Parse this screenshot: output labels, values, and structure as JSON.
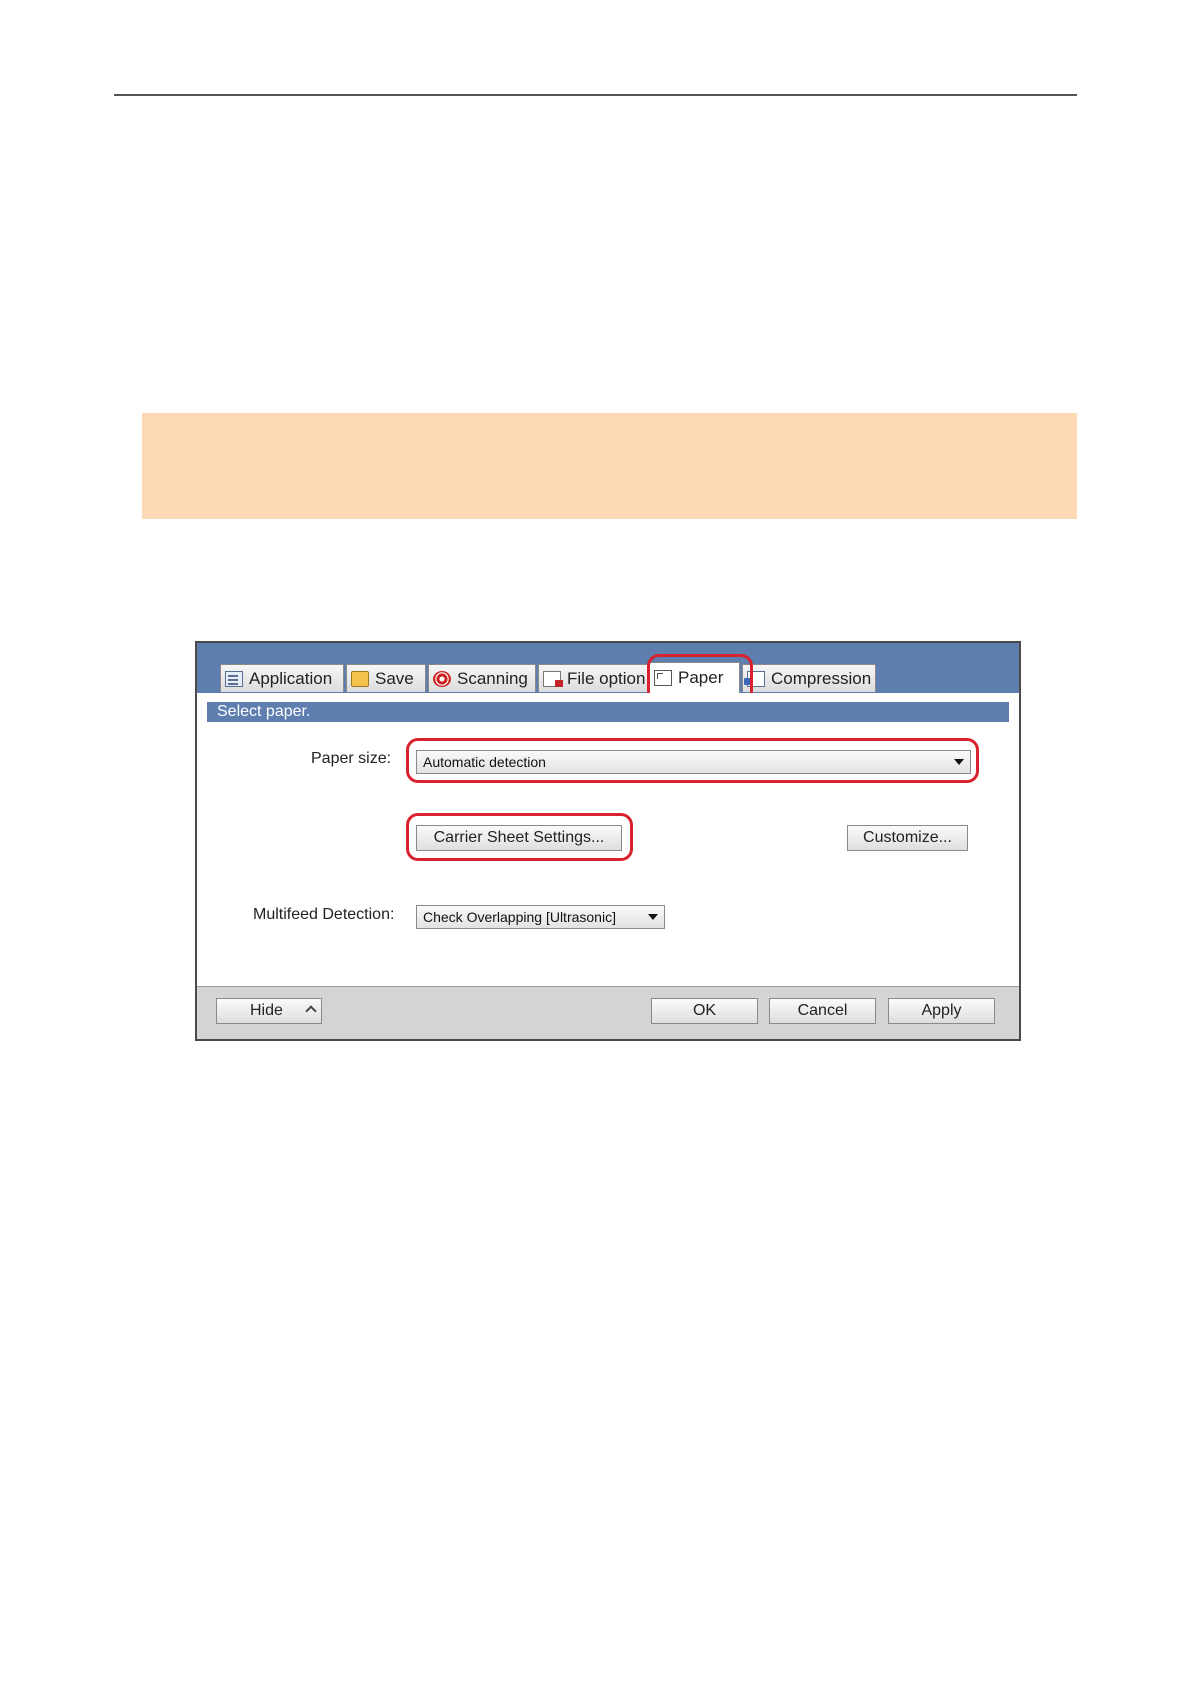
{
  "dialog": {
    "tabs": [
      {
        "label": "Application",
        "icon": "application-icon"
      },
      {
        "label": "Save",
        "icon": "save-folder-icon"
      },
      {
        "label": "Scanning",
        "icon": "scanning-icon"
      },
      {
        "label": "File option",
        "icon": "file-option-icon"
      },
      {
        "label": "Paper",
        "icon": "paper-icon",
        "active": true
      },
      {
        "label": "Compression",
        "icon": "compression-icon"
      }
    ],
    "banner": "Select paper.",
    "paper_size": {
      "label": "Paper size:",
      "value": "Automatic detection"
    },
    "carrier_button": "Carrier Sheet Settings...",
    "customize_button": "Customize...",
    "multifeed": {
      "label": "Multifeed Detection:",
      "value": "Check Overlapping [Ultrasonic]"
    },
    "footer": {
      "hide": "Hide",
      "ok": "OK",
      "cancel": "Cancel",
      "apply": "Apply"
    },
    "highlight_color": "#d9222d"
  }
}
